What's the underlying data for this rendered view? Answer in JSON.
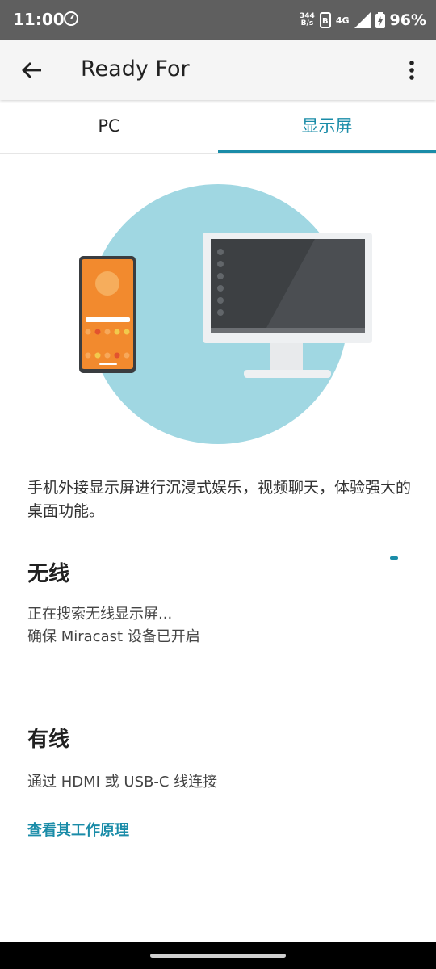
{
  "status_bar": {
    "time": "11:00",
    "net_speed_value": "344",
    "net_speed_unit": "B/s",
    "sim_label": "B",
    "network": "4G",
    "battery": "96%"
  },
  "app_bar": {
    "title": "Ready For"
  },
  "tabs": [
    {
      "label": "PC",
      "selected": false
    },
    {
      "label": "显示屏",
      "selected": true
    }
  ],
  "description": "手机外接显示屏进行沉浸式娱乐，视频聊天，体验强大的桌面功能。",
  "wireless": {
    "title": "无线",
    "searching": "正在搜索无线显示屏...",
    "hint": "确保 Miracast 设备已开启"
  },
  "wired": {
    "title": "有线",
    "description": "通过 HDMI 或 USB-C 线连接",
    "link": "查看其工作原理"
  },
  "colors": {
    "accent": "#1a8ca8",
    "illustration_circle": "#a0d7e2",
    "phone_orange": "#f28a2e"
  }
}
